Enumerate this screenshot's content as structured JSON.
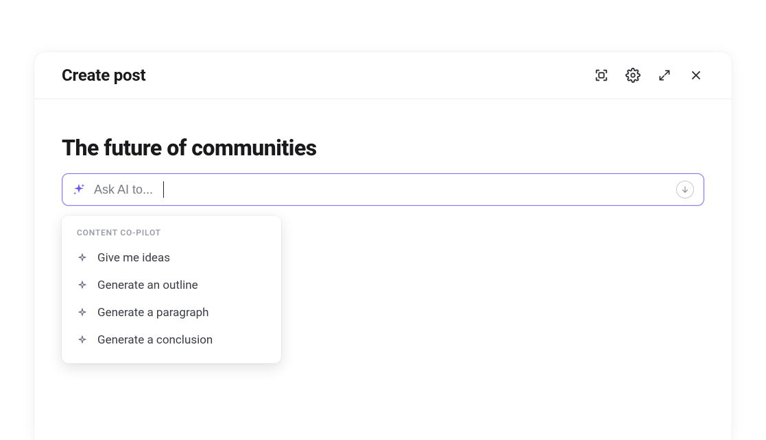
{
  "header": {
    "title": "Create post"
  },
  "post": {
    "title": "The future of communities"
  },
  "aiInput": {
    "placeholder": "Ask AI to...",
    "value": ""
  },
  "copilot": {
    "heading": "CONTENT CO-PILOT",
    "items": [
      {
        "label": "Give me ideas"
      },
      {
        "label": "Generate an outline"
      },
      {
        "label": "Generate a paragraph"
      },
      {
        "label": "Generate a conclusion"
      }
    ]
  }
}
